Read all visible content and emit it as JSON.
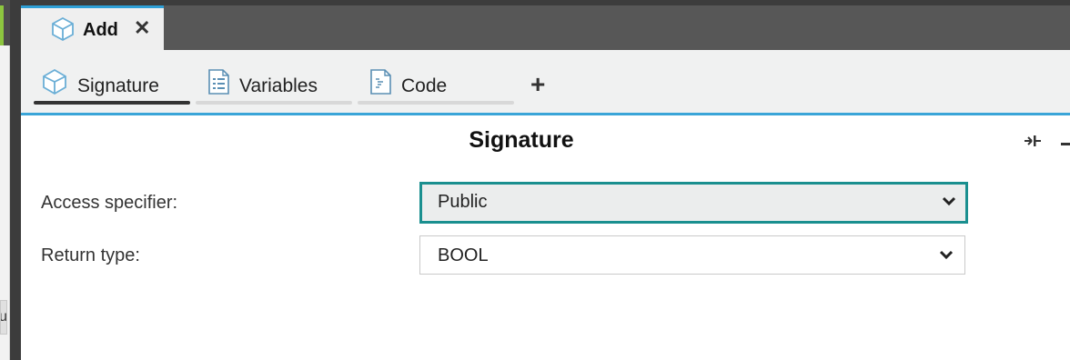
{
  "left_panel": {
    "stub_text": "u"
  },
  "document_tab": {
    "title": "Add",
    "close_glyph": "✕",
    "icon": "cube-icon"
  },
  "sub_tabs": [
    {
      "label": "Signature",
      "icon": "cube-icon",
      "active": true
    },
    {
      "label": "Variables",
      "icon": "list-document-icon",
      "active": false
    },
    {
      "label": "Code",
      "icon": "code-document-icon",
      "active": false
    }
  ],
  "add_tab_glyph": "+",
  "panel": {
    "title": "Signature",
    "fields": [
      {
        "label": "Access specifier:",
        "value": "Public",
        "focused": true
      },
      {
        "label": "Return type:",
        "value": "BOOL",
        "focused": false
      }
    ]
  },
  "colors": {
    "accent_blue": "#3aa5d8",
    "focus_teal": "#1a8f8f",
    "tab_bar_dark": "#575757"
  }
}
